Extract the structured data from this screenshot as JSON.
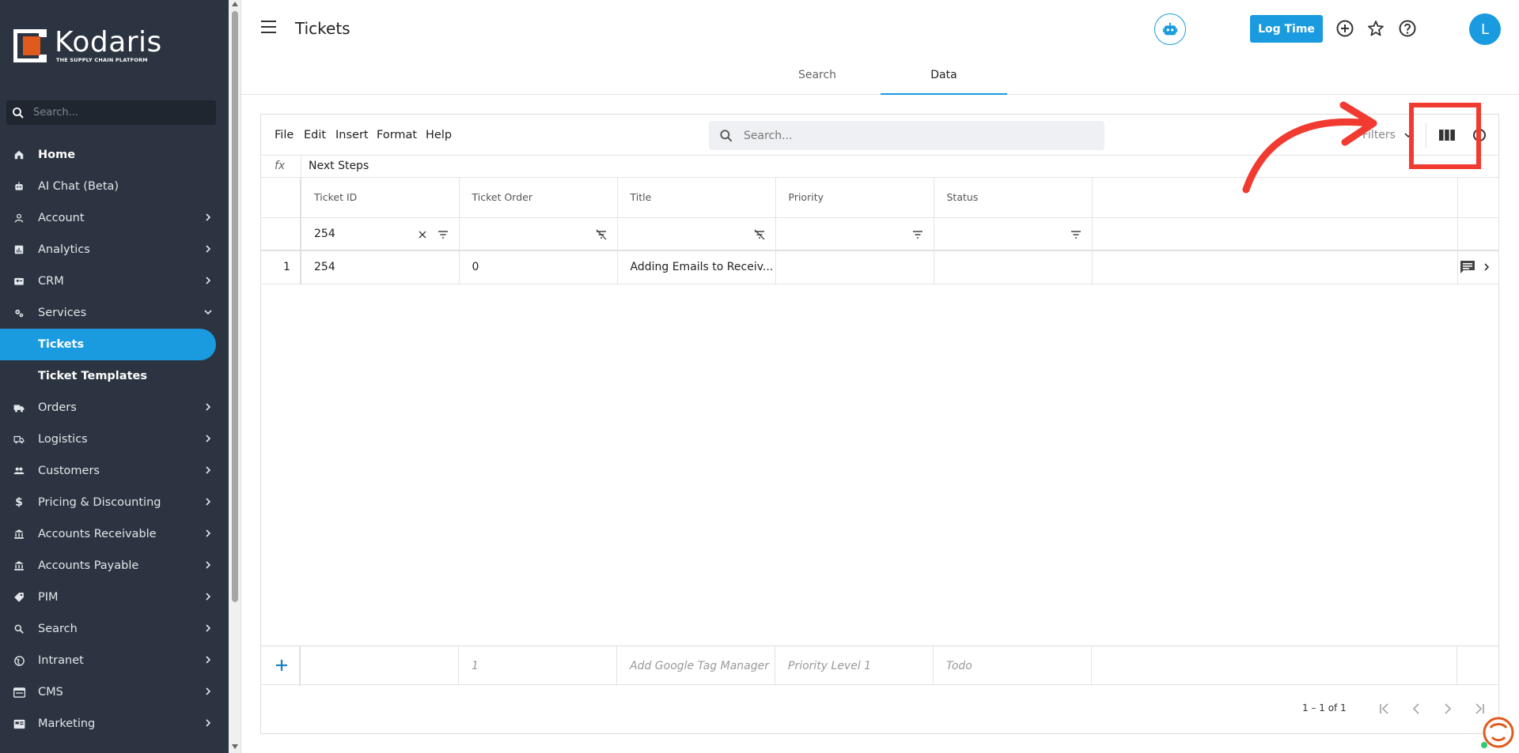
{
  "brand": {
    "name": "Kodaris",
    "tagline": "THE SUPPLY CHAIN PLATFORM"
  },
  "sidebar": {
    "search_placeholder": "Search...",
    "items": [
      {
        "label": "Home",
        "icon": "home-icon"
      },
      {
        "label": "AI Chat (Beta)",
        "icon": "robot-icon"
      },
      {
        "label": "Account",
        "icon": "person-icon"
      },
      {
        "label": "Analytics",
        "icon": "chart-icon"
      },
      {
        "label": "CRM",
        "icon": "contact-card-icon"
      },
      {
        "label": "Services",
        "icon": "gears-icon"
      },
      {
        "label": "Tickets"
      },
      {
        "label": "Ticket Templates"
      },
      {
        "label": "Orders",
        "icon": "truck-icon"
      },
      {
        "label": "Logistics",
        "icon": "shipping-icon"
      },
      {
        "label": "Customers",
        "icon": "people-icon"
      },
      {
        "label": "Pricing & Discounting",
        "icon": "dollar-icon"
      },
      {
        "label": "Accounts Receivable",
        "icon": "bank-icon"
      },
      {
        "label": "Accounts Payable",
        "icon": "bank-icon"
      },
      {
        "label": "PIM",
        "icon": "tag-icon"
      },
      {
        "label": "Search",
        "icon": "search-icon"
      },
      {
        "label": "Intranet",
        "icon": "globe-icon"
      },
      {
        "label": "CMS",
        "icon": "browser-icon"
      },
      {
        "label": "Marketing",
        "icon": "megaphone-icon"
      }
    ]
  },
  "header": {
    "title": "Tickets",
    "log_time_label": "Log Time",
    "avatar_initial": "L"
  },
  "tabs": [
    {
      "label": "Search"
    },
    {
      "label": "Data"
    }
  ],
  "sheet": {
    "menu": [
      "File",
      "Edit",
      "Insert",
      "Format",
      "Help"
    ],
    "search_placeholder": "Search...",
    "filters_label": "Filters",
    "fx_label": "fx",
    "formula_value": "Next Steps",
    "columns": [
      "Ticket ID",
      "Ticket Order",
      "Title",
      "Priority",
      "Status"
    ],
    "filter_values": [
      "254",
      "",
      "",
      "",
      ""
    ],
    "rows": [
      {
        "num": "1",
        "ticket_id": "254",
        "ticket_order": "0",
        "title": "Adding Emails to Receiv...",
        "priority": "",
        "status": ""
      }
    ],
    "new_row_placeholders": [
      "1",
      "Add Google Tag Manager",
      "Priority Level 1",
      "Todo"
    ],
    "pagination_range": "1 – 1 of 1"
  },
  "colors": {
    "sidebar_bg": "#2b3440",
    "accent": "#1a9be0",
    "brand_orange": "#e05a1e",
    "annotation_red": "#f13a30"
  }
}
